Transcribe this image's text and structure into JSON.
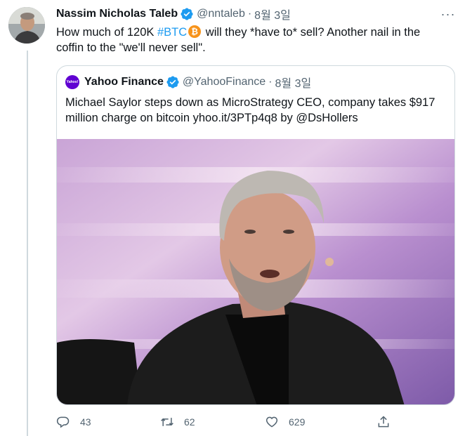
{
  "tweet": {
    "author_name": "Nassim Nicholas Taleb",
    "author_handle": "@nntaleb",
    "separator": "·",
    "date": "8월 3일",
    "more_label": "···",
    "text_before": "How much of 120K ",
    "hashtag": "#BTC",
    "text_after": "  will they *have to* sell? Another nail in the coffin to the \"we'll never sell\"."
  },
  "quote": {
    "avatar_text": "Yahoo!",
    "author_name": "Yahoo Finance",
    "author_handle": "@YahooFinance",
    "separator": "·",
    "date": "8월 3일",
    "text": "Michael Saylor steps down as MicroStrategy CEO, company takes $917 million charge on bitcoin yhoo.it/3PTp4q8 by @DsHollers"
  },
  "actions": {
    "reply_count": "43",
    "retweet_count": "62",
    "like_count": "629"
  },
  "icons": [
    "verified-icon",
    "bitcoin-icon",
    "more-icon",
    "reply-icon",
    "retweet-icon",
    "like-icon",
    "share-icon"
  ],
  "colors": {
    "link": "#1d9bf0",
    "secondary_text": "#536471",
    "border": "#cfd9de",
    "bitcoin": "#f7931a",
    "yahoo_purple": "#6001d2"
  }
}
